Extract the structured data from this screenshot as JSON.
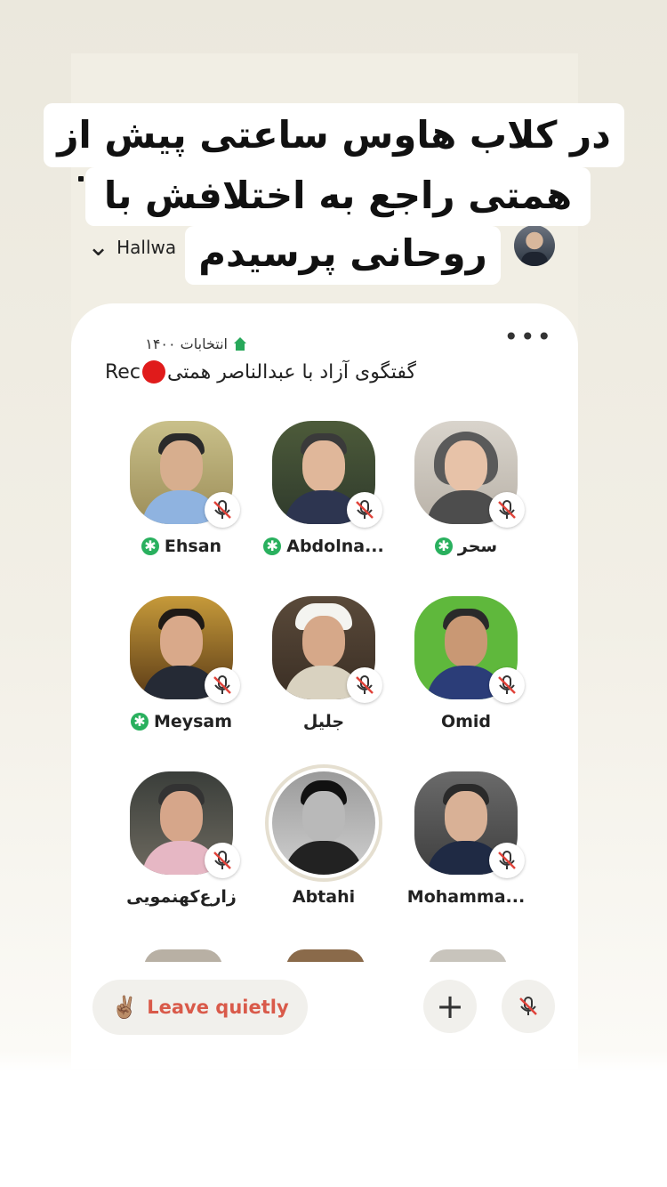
{
  "caption": {
    "line1": "در کلاب هاوس ساعتی پیش از",
    "line2": "همتی راجع به اختلافش با",
    "line3": "روحانی پرسیدم"
  },
  "header": {
    "back_label": "Hallwa",
    "chevron_icon": "chevron-down-icon"
  },
  "room": {
    "club_name": "انتخابات ۱۴۰۰",
    "club_icon": "home-icon",
    "more_icon": "more-dots-icon",
    "title_fa": "گفتگوی آزاد با عبدالناصر همتی",
    "title_rec": "Rec",
    "speakers": [
      {
        "name": "Ehsan",
        "moderator": true,
        "muted": true
      },
      {
        "name": "Abdolna...",
        "moderator": true,
        "muted": true
      },
      {
        "name": "سحر",
        "moderator": true,
        "muted": true
      },
      {
        "name": "Meysam",
        "moderator": true,
        "muted": true
      },
      {
        "name": "جلیل",
        "moderator": false,
        "muted": true
      },
      {
        "name": "Omid",
        "moderator": false,
        "muted": true
      },
      {
        "name": "زارع‌کهنمویی",
        "moderator": false,
        "muted": true
      },
      {
        "name": "Abtahi",
        "moderator": false,
        "muted": false,
        "speaking": true
      },
      {
        "name": "Mohamma...",
        "moderator": false,
        "muted": true
      }
    ]
  },
  "bottom": {
    "leave_label": "Leave quietly",
    "leave_emoji": "✌🏽",
    "add_icon": "plus-icon",
    "mic_icon": "mic-muted-icon",
    "add_glyph": "+",
    "moderator_glyph": "✱"
  },
  "colors": {
    "accent_green": "#29b05e",
    "leave_text": "#d95a4a",
    "rec_red": "#e01b1b"
  }
}
